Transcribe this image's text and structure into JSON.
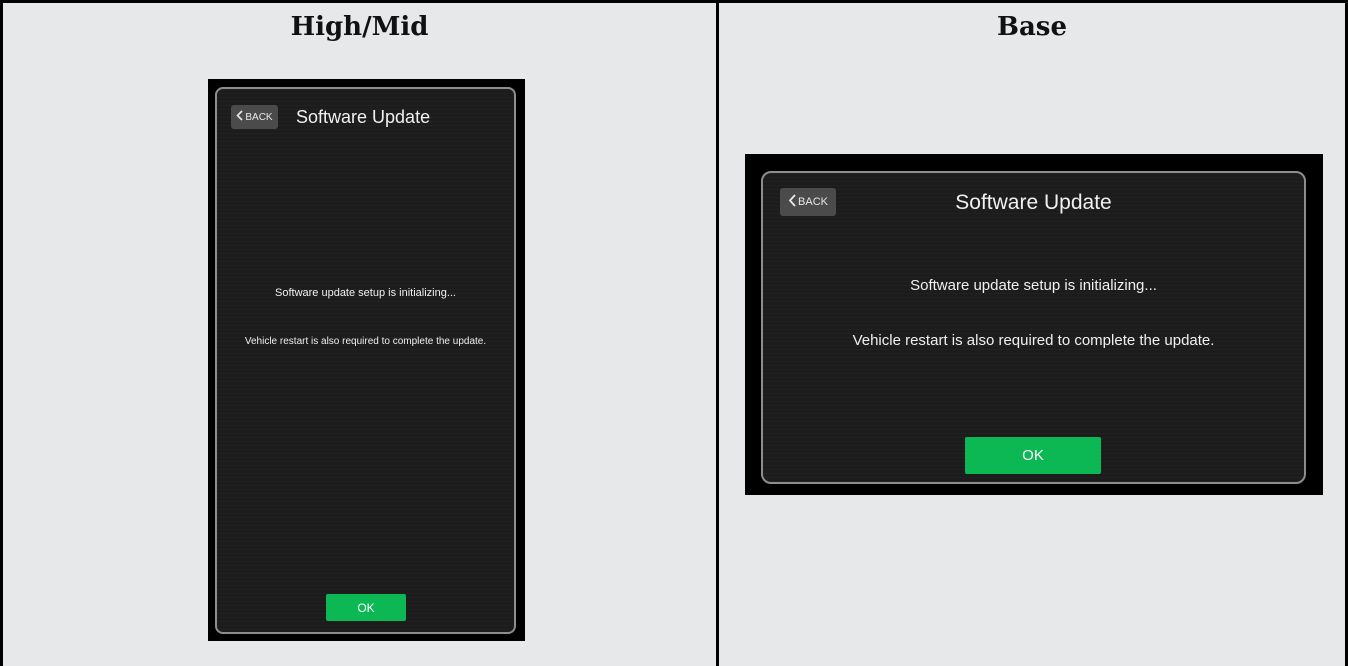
{
  "columns": {
    "left_title": "High/Mid",
    "right_title": "Base"
  },
  "high_mid_screen": {
    "back_label": "BACK",
    "title": "Software Update",
    "message_initializing": "Software update setup is initializing...",
    "message_restart": "Vehicle restart is also required to complete the update.",
    "ok_label": "OK"
  },
  "base_screen": {
    "back_label": "BACK",
    "title": "Software Update",
    "message_initializing": "Software update setup is initializing...",
    "message_restart": "Vehicle restart is also required to complete the update.",
    "ok_label": "OK"
  },
  "icons": {
    "back_chevron": "chevron-left-icon"
  },
  "colors": {
    "ok_button": "#0cb854",
    "screen_background": "#1c1c1c",
    "back_button": "#4b4b4b",
    "table_background": "#e7e8ea"
  }
}
